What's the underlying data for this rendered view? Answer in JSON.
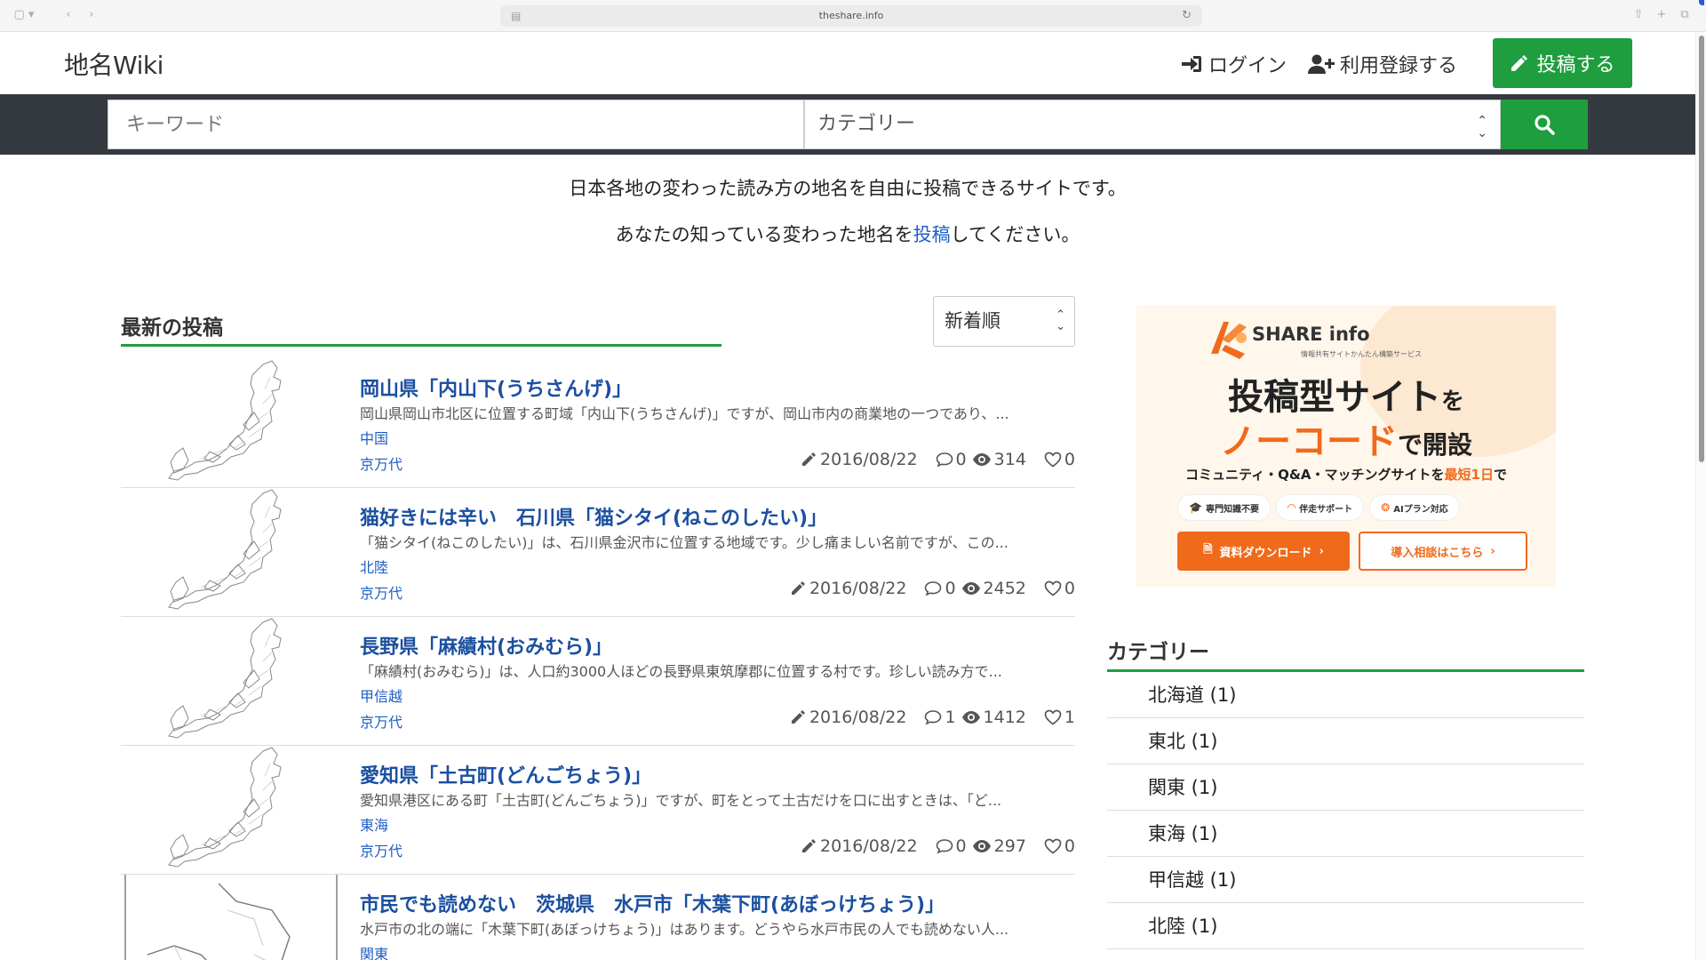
{
  "browser": {
    "url": "theshare.info"
  },
  "header": {
    "logo": "地名Wiki",
    "login": "ログイン",
    "register": "利用登録する",
    "post_button": "投稿する"
  },
  "search": {
    "keyword_placeholder": "キーワード",
    "category_selected": "カテゴリー"
  },
  "intro": {
    "line1": "日本各地の変わった読み方の地名を自由に投稿できるサイトです。",
    "line2_before": "あなたの知っている変わった地名を",
    "line2_link": "投稿",
    "line2_after": "してください。"
  },
  "latest": {
    "title": "最新の投稿",
    "sort_selected": "新着順",
    "posts": [
      {
        "title": "岡山県「内山下(うちさんげ)」",
        "desc": "岡山県岡山市北区に位置する町域「内山下(うちさんげ)」ですが、岡山市内の商業地の一つであり、...",
        "category": "中国",
        "author": "京万代",
        "date": "2016/08/22",
        "comments": "0",
        "views": "314",
        "likes": "0"
      },
      {
        "title": "猫好きには辛い　石川県「猫シタイ(ねこのしたい)」",
        "desc": "「猫シタイ(ねこのしたい)」は、石川県金沢市に位置する地域です。少し痛ましい名前ですが、この...",
        "category": "北陸",
        "author": "京万代",
        "date": "2016/08/22",
        "comments": "0",
        "views": "2452",
        "likes": "0"
      },
      {
        "title": "長野県「麻績村(おみむら)」",
        "desc": "「麻績村(おみむら)」は、人口約3000人ほどの長野県東筑摩郡に位置する村です。珍しい読み方で...",
        "category": "甲信越",
        "author": "京万代",
        "date": "2016/08/22",
        "comments": "1",
        "views": "1412",
        "likes": "1"
      },
      {
        "title": "愛知県「土古町(どんごちょう)」",
        "desc": "愛知県港区にある町「土古町(どんごちょう)」ですが、町をとって土古だけを口に出すときは、「ど...",
        "category": "東海",
        "author": "京万代",
        "date": "2016/08/22",
        "comments": "0",
        "views": "297",
        "likes": "0"
      },
      {
        "title": "市民でも読めない　茨城県　水戸市「木葉下町(あぼっけちょう)」",
        "desc": "水戸市の北の端に「木葉下町(あぼっけちょう)」はあります。どうやら水戸市民の人でも読めない人...",
        "category": "関東",
        "author": "",
        "date": "",
        "comments": "",
        "views": "",
        "likes": ""
      }
    ]
  },
  "ad": {
    "brand": "SHARE info",
    "brand_sub": "情報共有サイトかんたん構築サービス",
    "line1_main": "投稿型サイト",
    "line1_suffix": "を",
    "line2_main": "ノーコード",
    "line2_suffix": "で開設",
    "line3_before": "コミュニティ・Q&A・マッチングサイトを",
    "line3_highlight": "最短1日",
    "line3_after": "で",
    "chips": [
      "専門知識不要",
      "伴走サポート",
      "AIプラン対応"
    ],
    "download_button": "資料ダウンロード",
    "consult_button": "導入相談はこちら"
  },
  "categories": {
    "title": "カテゴリー",
    "items": [
      "北海道 (1)",
      "東北 (1)",
      "関東 (1)",
      "東海 (1)",
      "甲信越 (1)",
      "北陸 (1)"
    ]
  },
  "colors": {
    "accent_green": "#1e9e3e",
    "link_blue": "#1b4fa0",
    "dark_bar": "#343a40",
    "ad_orange": "#f06a1b"
  }
}
